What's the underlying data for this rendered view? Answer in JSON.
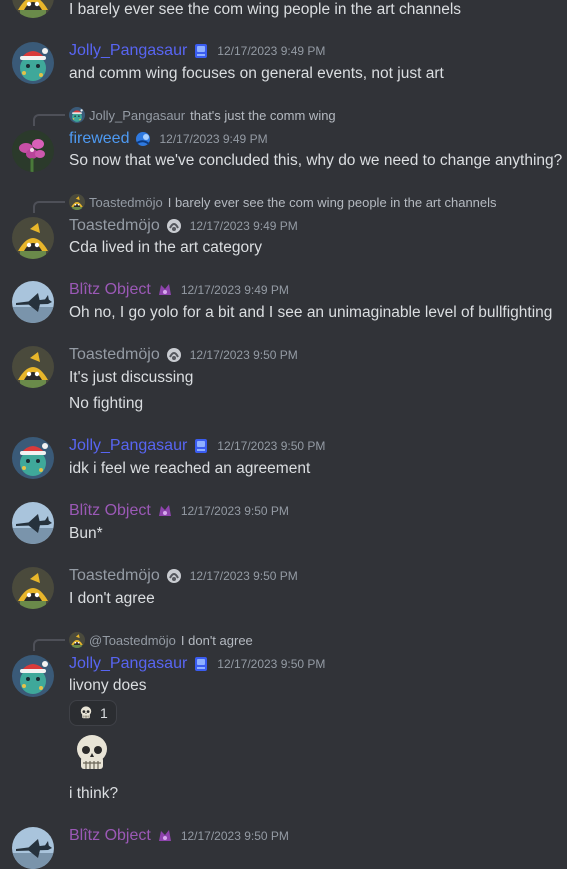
{
  "colors": {
    "background": "#313338",
    "text": "#dbdee1",
    "timestamp": "#949ba4",
    "jolly": "#5865f2",
    "fireweed": "#4e9af2",
    "toasted": "#949ba4",
    "blitz": "#9b59b6"
  },
  "messages": {
    "m0": {
      "text": "I barely ever see the com wing people in the art channels"
    },
    "m1": {
      "user": "Jolly_Pangasaur",
      "badge": "blue-gem-badge-icon",
      "time": "12/17/2023 9:49 PM",
      "text": "and comm wing focuses on general events, not just art"
    },
    "m2": {
      "reply_user": "Jolly_Pangasaur",
      "reply_text": "that's just the comm wing",
      "user": "fireweed",
      "badge": "blue-mascot-badge-icon",
      "time": "12/17/2023 9:49 PM",
      "text": "So now that we've concluded this, why do we need to change anything?"
    },
    "m3": {
      "reply_user": "Toastedmöjo",
      "reply_text": "I barely ever see the com wing people in the art channels",
      "user": "Toastedmöjo",
      "badge": "silver-badge-icon",
      "time": "12/17/2023 9:49 PM",
      "text": "Cda lived in the art category"
    },
    "m4": {
      "user": "Blîtz Object",
      "badge": "purple-badge-icon",
      "time": "12/17/2023 9:49 PM",
      "text": "Oh no, I go yolo for a bit and I see an unimaginable level of bullfighting"
    },
    "m5": {
      "user": "Toastedmöjo",
      "badge": "silver-badge-icon",
      "time": "12/17/2023 9:50 PM",
      "text": "It's just discussing",
      "text2": "No fighting"
    },
    "m6": {
      "user": "Jolly_Pangasaur",
      "badge": "blue-gem-badge-icon",
      "time": "12/17/2023 9:50 PM",
      "text": "idk i feel we reached an agreement"
    },
    "m7": {
      "user": "Blîtz Object",
      "badge": "purple-badge-icon",
      "time": "12/17/2023 9:50 PM",
      "text": "Bun*"
    },
    "m8": {
      "user": "Toastedmöjo",
      "badge": "silver-badge-icon",
      "time": "12/17/2023 9:50 PM",
      "text": "I don't agree"
    },
    "m9": {
      "reply_user": "@Toastedmöjo",
      "reply_text": "I don't agree",
      "user": "Jolly_Pangasaur",
      "badge": "blue-gem-badge-icon",
      "time": "12/17/2023 9:50 PM",
      "text": "livony does",
      "reaction_emoji": "skull-emoji-icon",
      "reaction_count": "1",
      "sticker": "skull-sticker-icon",
      "text2": "i think?"
    },
    "m10": {
      "user": "Blîtz Object",
      "badge": "purple-badge-icon",
      "time": "12/17/2023 9:50 PM"
    }
  }
}
